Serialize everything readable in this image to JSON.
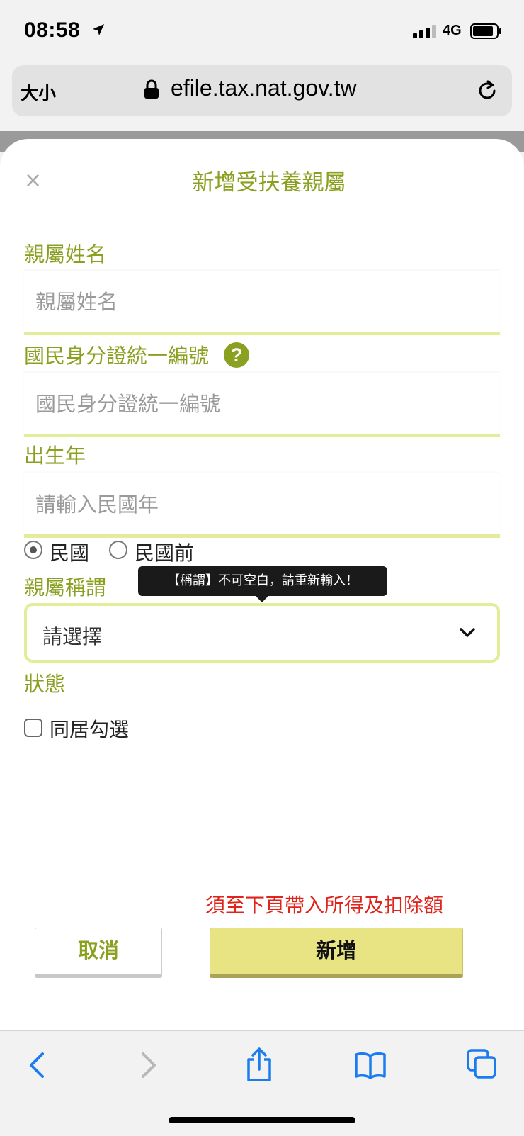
{
  "status_bar": {
    "time": "08:58",
    "network": "4G"
  },
  "browser": {
    "text_size": "大小",
    "url": "efile.tax.nat.gov.tw"
  },
  "dialog": {
    "title": "新增受扶養親屬",
    "close": "×",
    "name_label": "親屬姓名",
    "name_placeholder": "親屬姓名",
    "id_label": "國民身分證統一編號",
    "id_placeholder": "國民身分證統一編號",
    "help": "?",
    "birth_label": "出生年",
    "birth_placeholder": "請輸入民國年",
    "era_options": [
      "民國",
      "民國前"
    ],
    "era_selected": "民國",
    "relation_label": "親屬稱謂",
    "relation_error": "【稱謂】不可空白，請重新輸入！",
    "relation_value": "請選擇",
    "status_label": "狀態",
    "cohabit_label": "同居勾選",
    "cohabit_checked": false,
    "note": "須至下頁帶入所得及扣除額",
    "cancel": "取消",
    "add": "新增"
  },
  "colors": {
    "accent": "#8aa021",
    "field_border": "#e3ec98",
    "warning": "#e0241c",
    "add_button": "#e8e484",
    "ios_blue": "#1a7cf0"
  },
  "toolbar_icons": [
    "back-icon",
    "forward-icon",
    "share-icon",
    "bookmarks-icon",
    "tabs-icon"
  ]
}
